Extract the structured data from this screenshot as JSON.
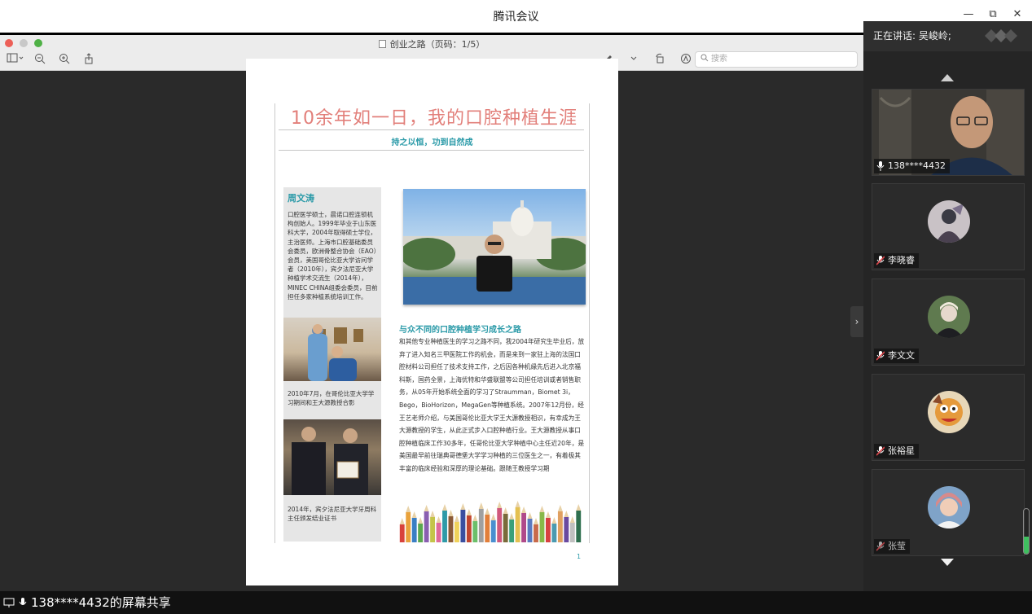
{
  "app": {
    "title": "腾讯会议"
  },
  "window_controls": {
    "minimize": "—",
    "restore": "⧉",
    "close": "✕"
  },
  "preview": {
    "doc_title": "创业之路（页码：1/5）",
    "search_placeholder": "搜索"
  },
  "document": {
    "headline": "10余年如一日，我的口腔种植生涯",
    "subhead": "持之以恒，功到自然成",
    "sidebar": {
      "name": "周文涛",
      "bio": "口腔医学硕士，晨诺口腔连锁机构创始人。1999年毕业于山东医科大学，2004年取得硕士学位，主治医师。上海市口腔基础委员会委员，欧洲骨整合协会（EAO）会员，美国哥伦比亚大学访问学者（2010年），宾夕法尼亚大学种植学术交流生（2014年），MINEC CHINA组委会委员，目前担任多家种植系统培训工作。",
      "caption1": "2010年7月，在哥伦比亚大学学习期间和王大源教授合影",
      "caption2": "2014年，宾夕法尼亚大学牙周科主任颁发结业证书"
    },
    "section_title": "与众不同的口腔种植学习成长之路",
    "section_body": "和其他专业种植医生的学习之路不同，我2004年研究生毕业后，放弃了进入知名三甲医院工作的机会，而是来到一家驻上海的法国口腔材料公司担任了技术支持工作，之后因各种机缘先后进入北京福科斯，国药全景，上海优特和华盛联盟等公司担任培训或者销售职务，从05年开始系统全面的学习了Straumman，Biomet 3i，Bego，BioHorizon，MegaGen等种植系统。2007年12月份，经王艺老师介绍，与美国哥伦比亚大学王大源教授相识，有幸成为王大源教授的学生，从此正式步入口腔种植行业。王大源教授从事口腔种植临床工作30多年，任哥伦比亚大学种植中心主任近20年，是美国最早前往瑞典哥德堡大学学习种植的三位医生之一，有着极其丰富的临床经验和深厚的理论基础。跟随王教授学习期",
    "page_number": "1"
  },
  "panel": {
    "speaking_label": "正在讲话: 吴峻岭;",
    "participants": [
      {
        "name": "138****4432",
        "mic": "on"
      },
      {
        "name": "李晓睿",
        "mic": "muted"
      },
      {
        "name": "李文文",
        "mic": "muted"
      },
      {
        "name": "张裕星",
        "mic": "muted"
      },
      {
        "name": "张莹",
        "mic": "muted"
      }
    ],
    "scroll_fraction": 0.38
  },
  "bottom_bar": {
    "share_text": "138****4432的屏幕共享"
  },
  "colors": {
    "headline": "#e27f7a",
    "accent_teal": "#2a9aa8",
    "muted_mic": "#e0464b"
  }
}
